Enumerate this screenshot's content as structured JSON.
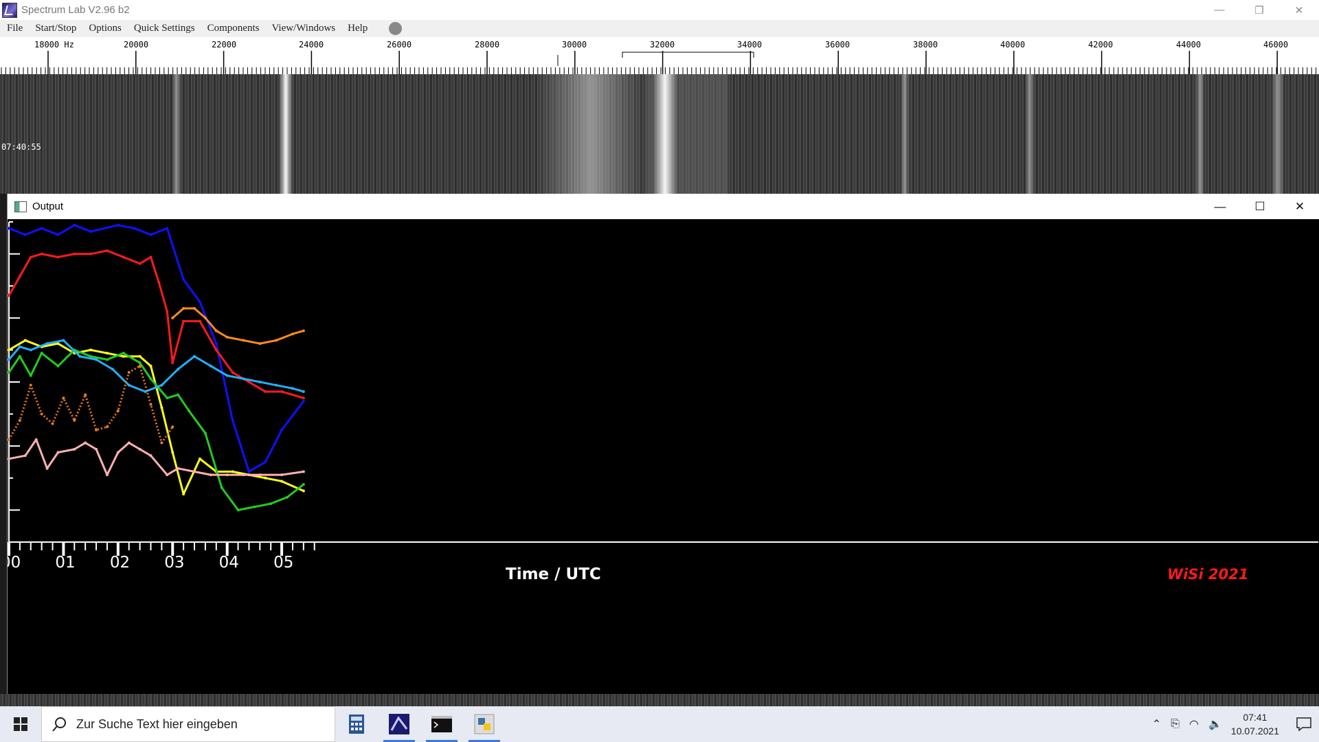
{
  "window": {
    "title": "Spectrum Lab V2.96 b2",
    "minimize": "—",
    "restore": "❐",
    "close": "✕"
  },
  "menu": [
    "File",
    "Start/Stop",
    "Options",
    "Quick Settings",
    "Components",
    "View/Windows",
    "Help"
  ],
  "frequency_scale": {
    "labels": [
      "18000 Hz",
      "20000",
      "22000",
      "24000",
      "26000",
      "28000",
      "30000",
      "32000",
      "34000",
      "36000",
      "38000",
      "40000",
      "42000",
      "44000",
      "46000"
    ]
  },
  "waterfall": {
    "timestamp": "07:40:55"
  },
  "output_window": {
    "title": "Output",
    "minimize": "—",
    "maximize": "☐",
    "close": "✕"
  },
  "chart_data": {
    "type": "line",
    "xlabel": "Time / UTC",
    "x_ticks": [
      "00",
      "01",
      "02",
      "03",
      "04",
      "05"
    ],
    "watermark": "WiSi 2021",
    "series": [
      {
        "color": "#1010ff",
        "x": [
          0.0,
          0.3,
          0.6,
          0.9,
          1.2,
          1.5,
          2.0,
          2.3,
          2.6,
          2.9,
          3.2,
          3.5,
          3.8,
          4.1,
          4.4,
          4.7,
          5.0,
          5.4
        ],
        "y": [
          9.8,
          9.6,
          9.8,
          9.6,
          9.9,
          9.7,
          9.9,
          9.8,
          9.6,
          9.8,
          8.2,
          7.5,
          6.2,
          3.8,
          2.2,
          2.5,
          3.5,
          4.4
        ]
      },
      {
        "color": "#ff1a1a",
        "x": [
          0.0,
          0.2,
          0.4,
          0.6,
          0.9,
          1.2,
          1.5,
          1.8,
          2.1,
          2.4,
          2.6,
          2.75,
          2.9,
          3.0,
          3.2,
          3.5,
          3.8,
          4.1,
          4.4,
          4.7,
          5.0,
          5.4
        ],
        "y": [
          7.7,
          8.3,
          8.9,
          9.0,
          8.9,
          9.0,
          9.0,
          9.1,
          8.9,
          8.7,
          8.9,
          8.1,
          7.2,
          5.6,
          6.9,
          6.9,
          6.0,
          5.3,
          5.0,
          4.7,
          4.7,
          4.5
        ]
      },
      {
        "color": "#ff8c1a",
        "x": [
          3.0,
          3.2,
          3.4,
          3.6,
          3.8,
          4.0,
          4.3,
          4.6,
          4.9,
          5.2,
          5.4
        ],
        "y": [
          7.0,
          7.3,
          7.3,
          7.0,
          6.6,
          6.4,
          6.3,
          6.2,
          6.3,
          6.5,
          6.6
        ]
      },
      {
        "color": "#ffff1a",
        "x": [
          0.0,
          0.3,
          0.6,
          0.9,
          1.2,
          1.5,
          1.8,
          2.1,
          2.4,
          2.6,
          2.8,
          3.0,
          3.2,
          3.5,
          3.8,
          4.1,
          4.4,
          4.7,
          5.0,
          5.4
        ],
        "y": [
          6.0,
          6.3,
          6.1,
          6.2,
          5.9,
          6.0,
          5.9,
          5.8,
          5.8,
          5.5,
          4.2,
          2.8,
          1.5,
          2.6,
          2.2,
          2.2,
          2.1,
          2.0,
          1.9,
          1.6
        ]
      },
      {
        "color": "#20cc20",
        "x": [
          0.0,
          0.2,
          0.4,
          0.6,
          0.9,
          1.2,
          1.5,
          1.8,
          2.1,
          2.4,
          2.6,
          2.9,
          3.1,
          3.3,
          3.6,
          3.9,
          4.2,
          4.5,
          4.8,
          5.1,
          5.4
        ],
        "y": [
          5.3,
          5.8,
          5.2,
          5.9,
          5.5,
          6.0,
          5.8,
          5.7,
          5.9,
          5.6,
          5.1,
          4.5,
          4.6,
          4.1,
          3.4,
          1.7,
          1.0,
          1.1,
          1.2,
          1.4,
          1.8
        ]
      },
      {
        "color": "#20b0ff",
        "x": [
          0.0,
          0.2,
          0.4,
          0.7,
          1.0,
          1.3,
          1.6,
          1.9,
          2.2,
          2.5,
          2.8,
          3.1,
          3.4,
          3.7,
          4.0,
          4.3,
          4.6,
          4.9,
          5.2,
          5.4
        ],
        "y": [
          5.7,
          6.1,
          6.0,
          6.2,
          6.3,
          5.8,
          5.7,
          5.4,
          4.9,
          4.7,
          4.9,
          5.4,
          5.8,
          5.5,
          5.2,
          5.1,
          5.0,
          4.9,
          4.8,
          4.7
        ]
      },
      {
        "color": "#e87a20",
        "x": [
          0.0,
          0.2,
          0.4,
          0.6,
          0.8,
          1.0,
          1.2,
          1.4,
          1.6,
          1.8,
          2.0,
          2.2,
          2.4,
          2.6,
          2.8,
          3.0
        ],
        "y": [
          3.2,
          3.8,
          4.9,
          4.0,
          3.7,
          4.5,
          3.8,
          4.6,
          3.5,
          3.6,
          4.1,
          5.3,
          5.5,
          4.3,
          3.1,
          3.6
        ]
      },
      {
        "color": "#ffb0b0",
        "x": [
          0.0,
          0.3,
          0.5,
          0.7,
          0.9,
          1.2,
          1.4,
          1.6,
          1.8,
          2.0,
          2.2,
          2.4,
          2.6,
          2.9,
          3.1,
          3.4,
          3.7,
          4.0,
          4.3,
          4.6,
          5.0,
          5.4
        ],
        "y": [
          2.6,
          2.7,
          3.2,
          2.3,
          2.8,
          2.9,
          3.1,
          2.9,
          2.1,
          2.8,
          3.1,
          2.9,
          2.7,
          2.1,
          2.3,
          2.2,
          2.1,
          2.1,
          2.1,
          2.1,
          2.1,
          2.2
        ]
      }
    ],
    "xlim": [
      0,
      24
    ],
    "ylim": [
      0,
      10
    ]
  },
  "taskbar": {
    "search_placeholder": "Zur Suche Text hier eingeben",
    "time": "07:41",
    "date": "10.07.2021"
  }
}
